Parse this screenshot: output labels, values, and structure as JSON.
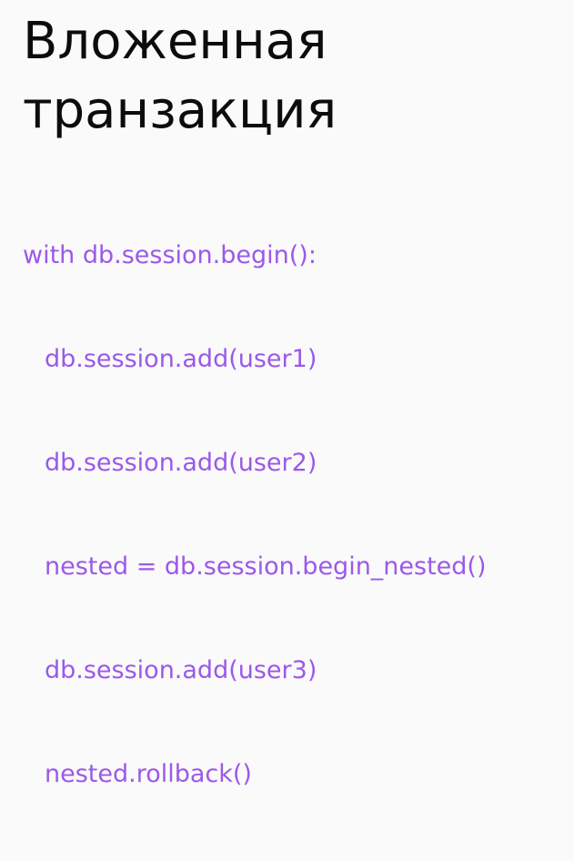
{
  "slide": {
    "title_lines": [
      "Вложенная",
      "транзакция"
    ],
    "code_lines": [
      "with db.session.begin():",
      "db.session.add(user1)",
      "db.session.add(user2)",
      "nested = db.session.begin_nested()",
      "db.session.add(user3)",
      "nested.rollback()"
    ]
  },
  "colors": {
    "background": "#fafafa",
    "title": "#0c0c0c",
    "code": "#9b59e8"
  }
}
